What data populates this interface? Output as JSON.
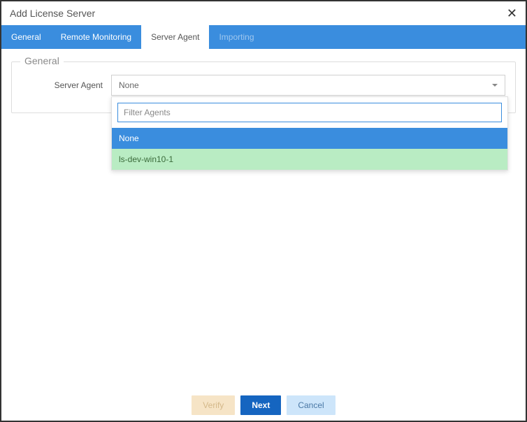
{
  "header": {
    "title": "Add License Server"
  },
  "tabs": {
    "general": "General",
    "remote": "Remote Monitoring",
    "server_agent": "Server Agent",
    "importing": "Importing"
  },
  "fieldset": {
    "legend": "General",
    "label_server_agent": "Server Agent",
    "select_value": "None"
  },
  "dropdown": {
    "filter_placeholder": "Filter Agents",
    "options": {
      "none": "None",
      "agent1": "ls-dev-win10-1"
    }
  },
  "footer": {
    "verify": "Verify",
    "next": "Next",
    "cancel": "Cancel"
  }
}
